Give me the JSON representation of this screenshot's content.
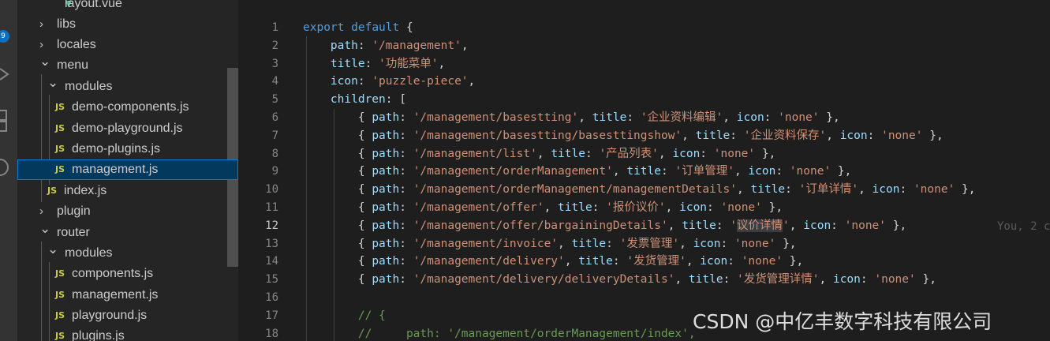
{
  "activity_bar": {
    "badge_count": "9"
  },
  "explorer": {
    "items": [
      {
        "label": "layout.vue",
        "type": "vue"
      },
      {
        "label": "libs",
        "type": "folder-collapsed"
      },
      {
        "label": "locales",
        "type": "folder-collapsed"
      },
      {
        "label": "menu",
        "type": "folder-expanded"
      },
      {
        "label": "modules",
        "type": "folder-expanded"
      },
      {
        "label": "demo-components.js",
        "type": "js"
      },
      {
        "label": "demo-playground.js",
        "type": "js"
      },
      {
        "label": "demo-plugins.js",
        "type": "js"
      },
      {
        "label": "management.js",
        "type": "js",
        "selected": true
      },
      {
        "label": "index.js",
        "type": "js"
      },
      {
        "label": "plugin",
        "type": "folder-collapsed"
      },
      {
        "label": "router",
        "type": "folder-expanded"
      },
      {
        "label": "modules",
        "type": "folder-expanded"
      },
      {
        "label": "components.js",
        "type": "js"
      },
      {
        "label": "management.js",
        "type": "js"
      },
      {
        "label": "playground.js",
        "type": "js"
      },
      {
        "label": "plugins.js",
        "type": "js"
      }
    ],
    "js_badge": "JS"
  },
  "editor": {
    "active_line": 12,
    "lines": [
      {
        "n": "1",
        "tokens": [
          [
            "kw",
            "export"
          ],
          [
            "pun",
            " "
          ],
          [
            "kw",
            "default"
          ],
          [
            "pun",
            " {"
          ]
        ]
      },
      {
        "n": "2",
        "tokens": [
          [
            "pun",
            "    "
          ],
          [
            "prop",
            "path"
          ],
          [
            "pun",
            ": "
          ],
          [
            "str",
            "'/management'"
          ],
          [
            "pun",
            ","
          ]
        ]
      },
      {
        "n": "3",
        "tokens": [
          [
            "pun",
            "    "
          ],
          [
            "prop",
            "title"
          ],
          [
            "pun",
            ": "
          ],
          [
            "str",
            "'功能菜单'"
          ],
          [
            "pun",
            ","
          ]
        ]
      },
      {
        "n": "4",
        "tokens": [
          [
            "pun",
            "    "
          ],
          [
            "prop",
            "icon"
          ],
          [
            "pun",
            ": "
          ],
          [
            "str",
            "'puzzle-piece'"
          ],
          [
            "pun",
            ","
          ]
        ]
      },
      {
        "n": "5",
        "tokens": [
          [
            "pun",
            "    "
          ],
          [
            "prop",
            "children"
          ],
          [
            "pun",
            ": ["
          ]
        ]
      },
      {
        "n": "6",
        "tokens": [
          [
            "pun",
            "        { "
          ],
          [
            "prop",
            "path"
          ],
          [
            "pun",
            ": "
          ],
          [
            "str",
            "'/management/basestting'"
          ],
          [
            "pun",
            ", "
          ],
          [
            "prop",
            "title"
          ],
          [
            "pun",
            ": "
          ],
          [
            "str",
            "'企业资料编辑'"
          ],
          [
            "pun",
            ", "
          ],
          [
            "prop",
            "icon"
          ],
          [
            "pun",
            ": "
          ],
          [
            "str",
            "'none'"
          ],
          [
            "pun",
            " },"
          ]
        ]
      },
      {
        "n": "7",
        "tokens": [
          [
            "pun",
            "        { "
          ],
          [
            "prop",
            "path"
          ],
          [
            "pun",
            ": "
          ],
          [
            "str",
            "'/management/basestting/basesttingshow'"
          ],
          [
            "pun",
            ", "
          ],
          [
            "prop",
            "title"
          ],
          [
            "pun",
            ": "
          ],
          [
            "str",
            "'企业资料保存'"
          ],
          [
            "pun",
            ", "
          ],
          [
            "prop",
            "icon"
          ],
          [
            "pun",
            ": "
          ],
          [
            "str",
            "'none'"
          ],
          [
            "pun",
            " },"
          ]
        ]
      },
      {
        "n": "8",
        "tokens": [
          [
            "pun",
            "        { "
          ],
          [
            "prop",
            "path"
          ],
          [
            "pun",
            ": "
          ],
          [
            "str",
            "'/management/list'"
          ],
          [
            "pun",
            ", "
          ],
          [
            "prop",
            "title"
          ],
          [
            "pun",
            ": "
          ],
          [
            "str",
            "'产品列表'"
          ],
          [
            "pun",
            ", "
          ],
          [
            "prop",
            "icon"
          ],
          [
            "pun",
            ": "
          ],
          [
            "str",
            "'none'"
          ],
          [
            "pun",
            " },"
          ]
        ]
      },
      {
        "n": "9",
        "tokens": [
          [
            "pun",
            "        { "
          ],
          [
            "prop",
            "path"
          ],
          [
            "pun",
            ": "
          ],
          [
            "str",
            "'/management/orderManagement'"
          ],
          [
            "pun",
            ", "
          ],
          [
            "prop",
            "title"
          ],
          [
            "pun",
            ": "
          ],
          [
            "str",
            "'订单管理'"
          ],
          [
            "pun",
            ", "
          ],
          [
            "prop",
            "icon"
          ],
          [
            "pun",
            ": "
          ],
          [
            "str",
            "'none'"
          ],
          [
            "pun",
            " },"
          ]
        ]
      },
      {
        "n": "10",
        "tokens": [
          [
            "pun",
            "        { "
          ],
          [
            "prop",
            "path"
          ],
          [
            "pun",
            ": "
          ],
          [
            "str",
            "'/management/orderManagement/managementDetails'"
          ],
          [
            "pun",
            ", "
          ],
          [
            "prop",
            "title"
          ],
          [
            "pun",
            ": "
          ],
          [
            "str",
            "'订单详情'"
          ],
          [
            "pun",
            ", "
          ],
          [
            "prop",
            "icon"
          ],
          [
            "pun",
            ": "
          ],
          [
            "str",
            "'none'"
          ],
          [
            "pun",
            " },"
          ]
        ]
      },
      {
        "n": "11",
        "tokens": [
          [
            "pun",
            "        { "
          ],
          [
            "prop",
            "path"
          ],
          [
            "pun",
            ": "
          ],
          [
            "str",
            "'/management/offer'"
          ],
          [
            "pun",
            ", "
          ],
          [
            "prop",
            "title"
          ],
          [
            "pun",
            ": "
          ],
          [
            "str",
            "'报价议价'"
          ],
          [
            "pun",
            ", "
          ],
          [
            "prop",
            "icon"
          ],
          [
            "pun",
            ": "
          ],
          [
            "str",
            "'none'"
          ],
          [
            "pun",
            " },"
          ]
        ]
      },
      {
        "n": "12",
        "tokens": [
          [
            "pun",
            "        { "
          ],
          [
            "prop",
            "path"
          ],
          [
            "pun",
            ": "
          ],
          [
            "str",
            "'/management/offer/bargainingDetails'"
          ],
          [
            "pun",
            ", "
          ],
          [
            "prop",
            "title"
          ],
          [
            "pun",
            ": "
          ],
          [
            "str",
            "'"
          ],
          [
            "strhl",
            "议价详情"
          ],
          [
            "str",
            "'"
          ],
          [
            "pun",
            ", "
          ],
          [
            "prop",
            "icon"
          ],
          [
            "pun",
            ": "
          ],
          [
            "str",
            "'none'"
          ],
          [
            "pun",
            " },"
          ]
        ]
      },
      {
        "n": "13",
        "tokens": [
          [
            "pun",
            "        { "
          ],
          [
            "prop",
            "path"
          ],
          [
            "pun",
            ": "
          ],
          [
            "str",
            "'/management/invoice'"
          ],
          [
            "pun",
            ", "
          ],
          [
            "prop",
            "title"
          ],
          [
            "pun",
            ": "
          ],
          [
            "str",
            "'发票管理'"
          ],
          [
            "pun",
            ", "
          ],
          [
            "prop",
            "icon"
          ],
          [
            "pun",
            ": "
          ],
          [
            "str",
            "'none'"
          ],
          [
            "pun",
            " },"
          ]
        ]
      },
      {
        "n": "14",
        "tokens": [
          [
            "pun",
            "        { "
          ],
          [
            "prop",
            "path"
          ],
          [
            "pun",
            ": "
          ],
          [
            "str",
            "'/management/delivery'"
          ],
          [
            "pun",
            ", "
          ],
          [
            "prop",
            "title"
          ],
          [
            "pun",
            ": "
          ],
          [
            "str",
            "'发货管理'"
          ],
          [
            "pun",
            ", "
          ],
          [
            "prop",
            "icon"
          ],
          [
            "pun",
            ": "
          ],
          [
            "str",
            "'none'"
          ],
          [
            "pun",
            " },"
          ]
        ]
      },
      {
        "n": "15",
        "tokens": [
          [
            "pun",
            "        { "
          ],
          [
            "prop",
            "path"
          ],
          [
            "pun",
            ": "
          ],
          [
            "str",
            "'/management/delivery/deliveryDetails'"
          ],
          [
            "pun",
            ", "
          ],
          [
            "prop",
            "title"
          ],
          [
            "pun",
            ": "
          ],
          [
            "str",
            "'发货管理详情'"
          ],
          [
            "pun",
            ", "
          ],
          [
            "prop",
            "icon"
          ],
          [
            "pun",
            ": "
          ],
          [
            "str",
            "'none'"
          ],
          [
            "pun",
            " },"
          ]
        ]
      },
      {
        "n": "16",
        "tokens": []
      },
      {
        "n": "17",
        "tokens": [
          [
            "com",
            "        // {"
          ]
        ]
      },
      {
        "n": "18",
        "tokens": [
          [
            "com",
            "        //     path: '/management/orderManagement/index',"
          ]
        ]
      }
    ],
    "blame": "You, 2 c"
  },
  "watermark": "CSDN @中亿丰数字科技有限公司",
  "colors": {
    "keyword": "#569cd6",
    "property": "#9cdcfe",
    "string": "#ce9178",
    "comment": "#6a9955",
    "selection": "#04395e"
  }
}
